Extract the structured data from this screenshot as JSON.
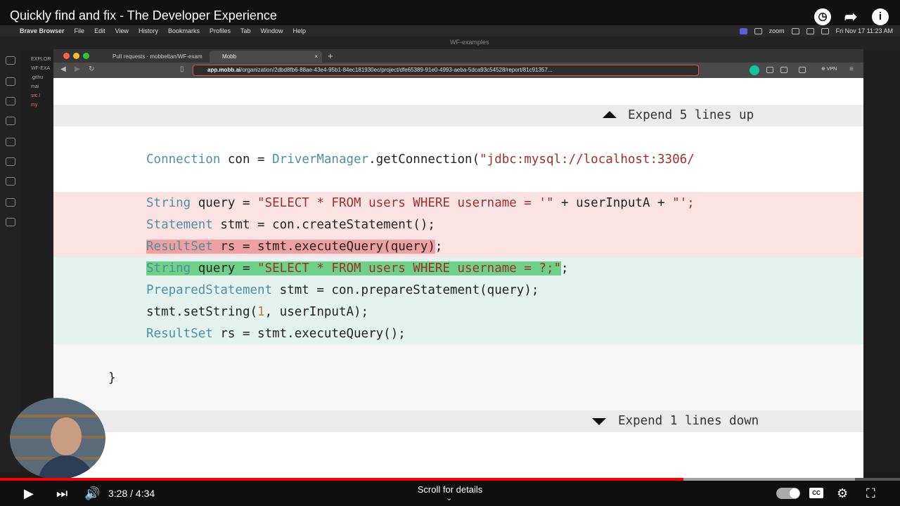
{
  "video": {
    "title": "Quickly find and fix - The Developer Experience",
    "current_time": "3:28",
    "duration": "4:34",
    "progress": 0.759,
    "buffered": 0.95,
    "scroll_hint": "Scroll for details"
  },
  "macos": {
    "menu": [
      "Brave Browser",
      "File",
      "Edit",
      "View",
      "History",
      "Bookmarks",
      "Profiles",
      "Tab",
      "Window",
      "Help"
    ],
    "zoom_label": "zoom",
    "clock": "Fri Nov 17  11:23 AM"
  },
  "vscode": {
    "window_title": "WF-examples",
    "explorer_header": "EXPLOR",
    "explorer_items": [
      "WF-EXA",
      ".githu",
      "mai",
      "src /",
      "my"
    ]
  },
  "browser": {
    "tabs": [
      {
        "label": "Pull requests · mobbeltan/WF-exam"
      },
      {
        "label": "Mobb",
        "close": "×"
      }
    ],
    "new_tab": "+",
    "url_host": "app.mobb.ai",
    "url_path": "/organization/2dbd8fb6-88ae-43e4-95b1-84ec181930ec/project/dfe65389-91e0-4993-aeba-5dca93c54528/report/81c91357...",
    "vpn": "⊕ VPN"
  },
  "diff": {
    "expand_up": "Expend 5 lines up",
    "expand_down": "Expend 1 lines down",
    "context_line": {
      "kw1": "Connection",
      "mid": " con = ",
      "kw2": "DriverManager",
      "call": ".getConnection(",
      "str": "\"jdbc:mysql://localhost:3306/"
    },
    "removed": [
      {
        "kw": "String",
        "rest": " query = ",
        "str": "\"SELECT * FROM users WHERE username = '\"",
        "tail": " + userInputA + ",
        "str2": "\"';"
      },
      {
        "kw": "Statement",
        "rest": " stmt = con.createStatement();"
      },
      {
        "kw": "ResultSet",
        "rest": " rs = stmt.executeQuery(query)",
        "tail": ";"
      }
    ],
    "added": [
      {
        "kw": "String",
        "rest": " query = ",
        "str": "\"SELECT * FROM users WHERE username = ?;\"",
        "tail": ";"
      },
      {
        "kw": "PreparedStatement",
        "rest": " stmt = con.prepareStatement(query);"
      },
      {
        "pre": "stmt.setString(",
        "num": "1",
        "rest": ", userInputA);"
      },
      {
        "kw": "ResultSet",
        "rest": " rs = stmt.executeQuery();"
      }
    ],
    "closing_brace": "}"
  }
}
